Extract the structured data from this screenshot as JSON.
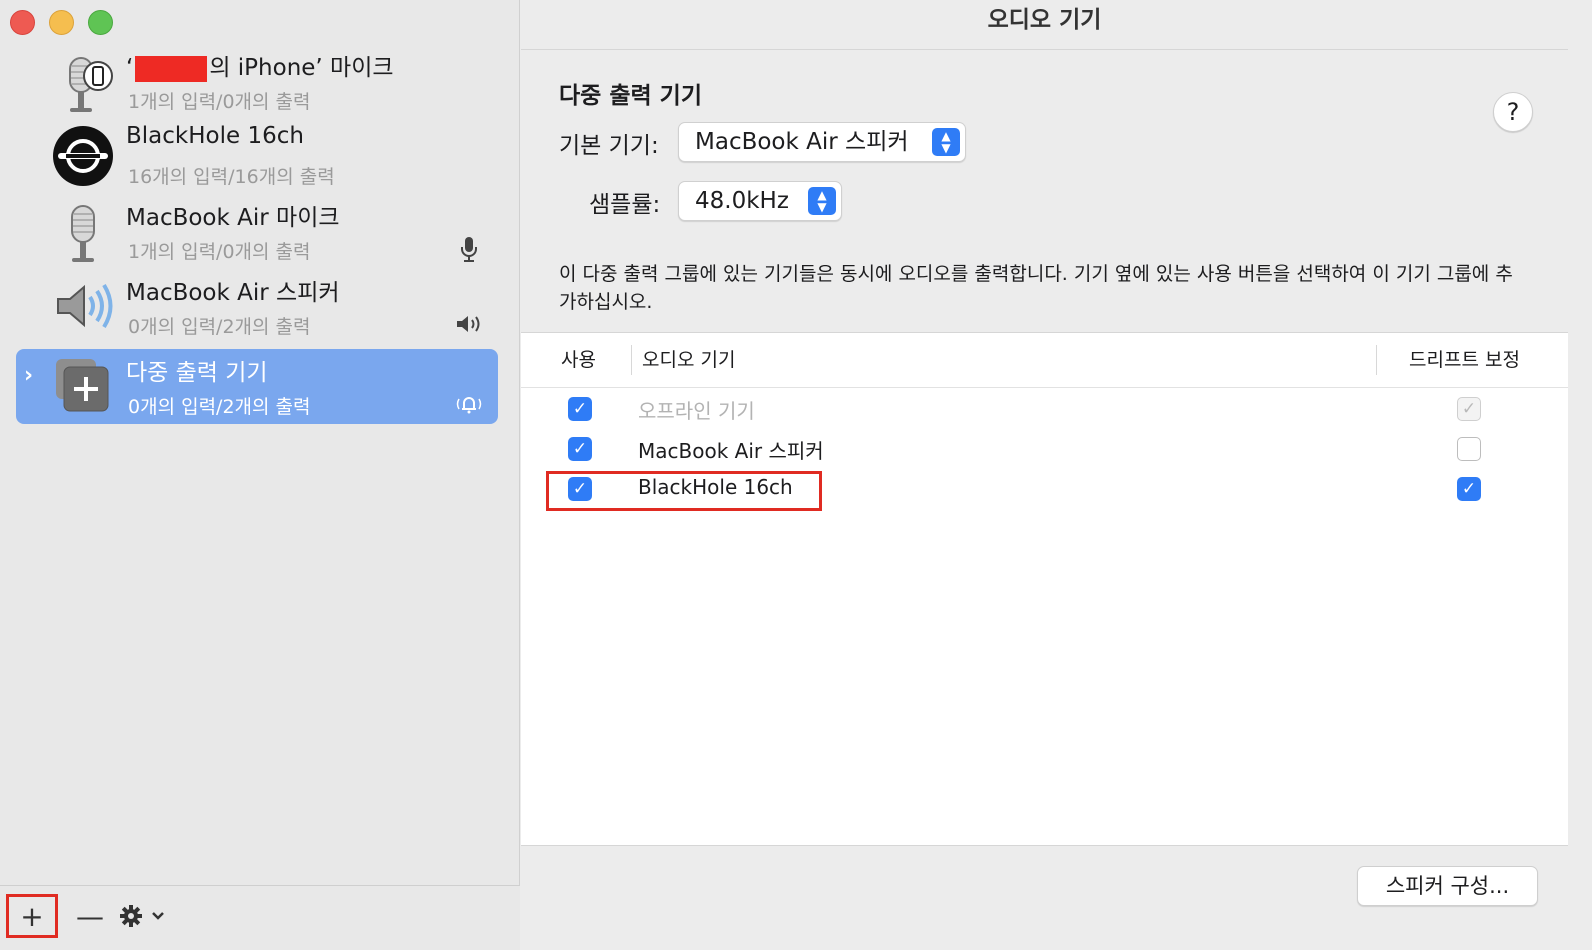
{
  "window": {
    "title": "오디오 기기"
  },
  "sidebar": {
    "devices": [
      {
        "name_prefix": "‘",
        "name_suffix": "의 iPhone’ 마이크",
        "sub": "1개의 입력/0개의 출력",
        "icon": "iphone-mic-icon"
      },
      {
        "name": "BlackHole 16ch",
        "sub": "16개의 입력/16개의 출력",
        "icon": "blackhole-icon"
      },
      {
        "name": "MacBook Air 마이크",
        "sub": "1개의 입력/0개의 출력",
        "icon": "microphone-icon",
        "status_icon": "mic-status-icon"
      },
      {
        "name": "MacBook Air 스피커",
        "sub": "0개의 입력/2개의 출력",
        "icon": "speaker-icon",
        "status_icon": "speaker-status-icon"
      },
      {
        "name": "다중 출력 기기",
        "sub": "0개의 입력/2개의 출력",
        "icon": "multi-output-icon",
        "status_icon": "bell-status-icon",
        "selected": true
      }
    ],
    "toolbar": {
      "add_label": "+",
      "remove_label": "—"
    }
  },
  "main": {
    "section_title": "다중 출력 기기",
    "help_label": "?",
    "primary_device_label": "기본 기기:",
    "primary_device_value": "MacBook Air 스피커",
    "sample_rate_label": "샘플률:",
    "sample_rate_value": "48.0kHz",
    "description": "이 다중 출력 그룹에 있는 기기들은 동시에 오디오를 출력합니다. 기기 옆에 있는 사용 버튼을 선택하여 이 기기 그룹에 추가하십시오.",
    "table": {
      "headers": [
        "사용",
        "오디오 기기",
        "드리프트 보정"
      ],
      "rows": [
        {
          "use": true,
          "name": "오프라인 기기",
          "drift": true,
          "disabled": true
        },
        {
          "use": true,
          "name": "MacBook Air 스피커",
          "drift": false,
          "disabled": false
        },
        {
          "use": true,
          "name": "BlackHole 16ch",
          "drift": true,
          "disabled": false
        }
      ]
    },
    "configure_speakers_label": "스피커 구성..."
  },
  "colors": {
    "accent": "#2f7cf6",
    "selection": "#7aa7ee",
    "annotation": "#e02b22"
  }
}
